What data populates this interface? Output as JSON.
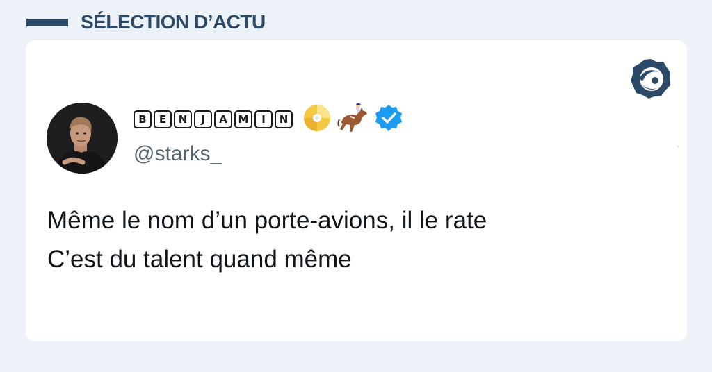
{
  "header": {
    "title": "SÉLECTION D’ACTU"
  },
  "logo": {
    "icon": "fish-eye-logo-icon"
  },
  "tweet": {
    "display_name_letters": [
      "B",
      "E",
      "N",
      "J",
      "A",
      "M",
      "I",
      "N"
    ],
    "handle": "@starks_",
    "lines": [
      "Même le nom d’un porte-avions, il le rate",
      "C’est du talent quand même"
    ],
    "badges": [
      "cd-icon",
      "horse-racing-icon",
      "verified-badge-icon"
    ]
  },
  "colors": {
    "background": "#edf2f9",
    "brand_navy": "#2c4a68",
    "verified_blue": "#1d9bf0",
    "handle_gray": "#536471",
    "text": "#0f1419"
  }
}
